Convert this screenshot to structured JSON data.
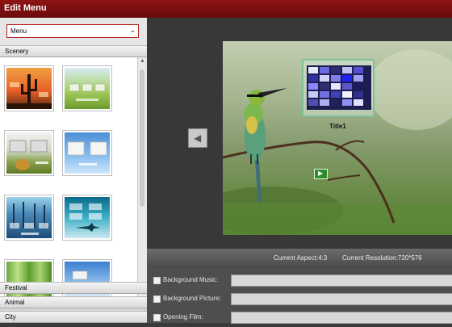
{
  "window": {
    "title": "Edit Menu"
  },
  "left_panel": {
    "dropdown_value": "Menu",
    "categories": [
      "Scenery",
      "Festival",
      "Animal",
      "City"
    ]
  },
  "templates": [
    {
      "name": "desert-sunset"
    },
    {
      "name": "green-field-frames"
    },
    {
      "name": "hay-bale-frames"
    },
    {
      "name": "sky-frames"
    },
    {
      "name": "winter-forest"
    },
    {
      "name": "ocean-plane"
    },
    {
      "name": "bamboo"
    },
    {
      "name": "clouds"
    }
  ],
  "preview": {
    "title_label": "Title1",
    "prev_arrow_icon": "chevron-left-icon",
    "play_icon": "play-icon"
  },
  "status_bar": {
    "aspect": "Current Aspect:4:3",
    "resolution": "Current Resolution:720*576"
  },
  "form": {
    "background_music": "Background Music:",
    "background_picture": "Background Picture:",
    "opening_film": "Opening Film:"
  },
  "colors": {
    "title_bar": "#7a0e0e",
    "dropdown_border": "#b41e1e",
    "play_button": "#2d8d2d",
    "menu_frame": "#7ec09a"
  }
}
